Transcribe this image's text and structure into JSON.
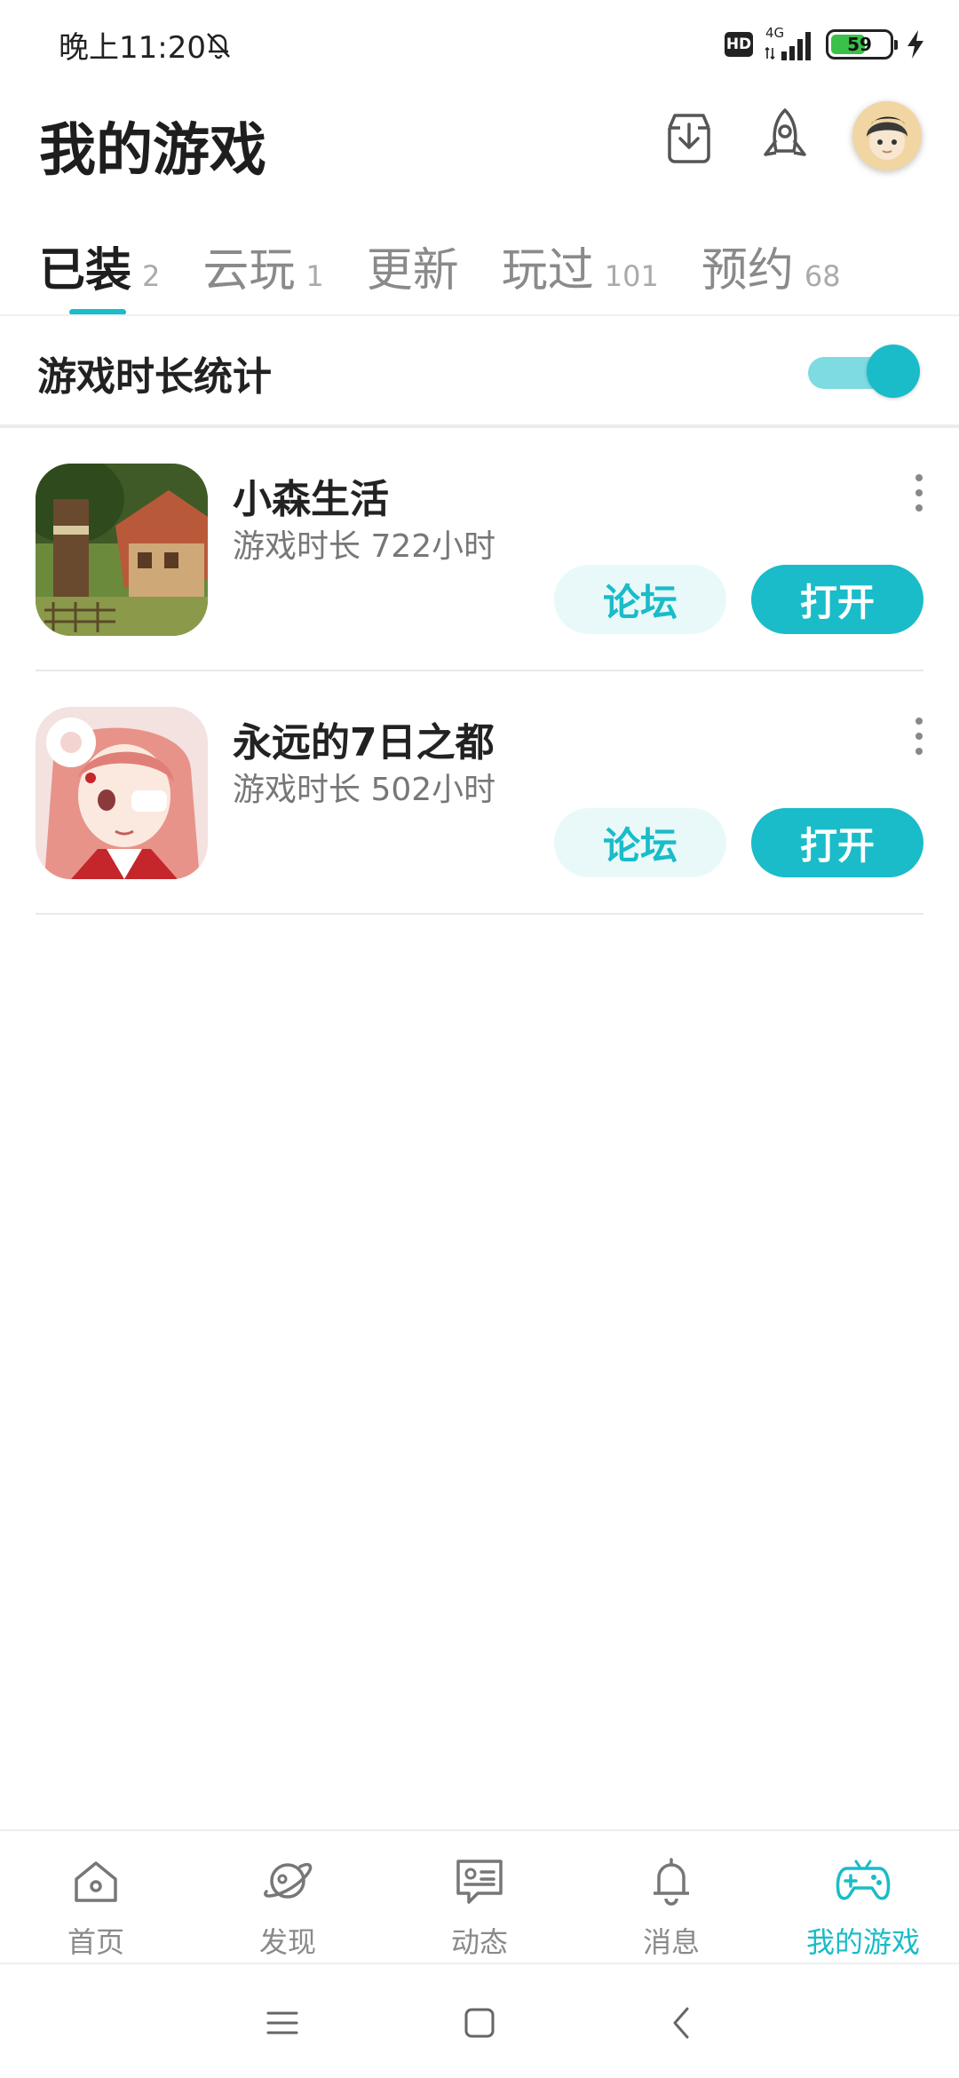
{
  "status_bar": {
    "time": "晚上11:20",
    "hd": "HD",
    "network": "4G",
    "battery": "59",
    "battery_fraction": 0.59
  },
  "header": {
    "title": "我的游戏",
    "icons": [
      "download-icon",
      "rocket-icon"
    ],
    "avatar": "user-avatar"
  },
  "tabs": [
    {
      "label": "已装",
      "count": "2",
      "active": true
    },
    {
      "label": "云玩",
      "count": "1"
    },
    {
      "label": "更新",
      "count": ""
    },
    {
      "label": "玩过",
      "count": "101"
    },
    {
      "label": "预约",
      "count": "68"
    }
  ],
  "stats": {
    "label": "游戏时长统计",
    "enabled": true
  },
  "games": [
    {
      "title": "小森生活",
      "playtime": "游戏时长 722小时",
      "forum_label": "论坛",
      "open_label": "打开"
    },
    {
      "title": "永远的7日之都",
      "playtime": "游戏时长 502小时",
      "forum_label": "论坛",
      "open_label": "打开"
    }
  ],
  "bottom_nav": [
    {
      "label": "首页",
      "icon": "home-icon"
    },
    {
      "label": "发现",
      "icon": "planet-icon"
    },
    {
      "label": "动态",
      "icon": "feed-icon"
    },
    {
      "label": "消息",
      "icon": "bell-icon"
    },
    {
      "label": "我的游戏",
      "icon": "gamepad-icon",
      "active": true
    }
  ],
  "colors": {
    "accent": "#19bcc8",
    "accent_light": "#e9f9fa",
    "toggle_track": "#7fdbe2"
  }
}
